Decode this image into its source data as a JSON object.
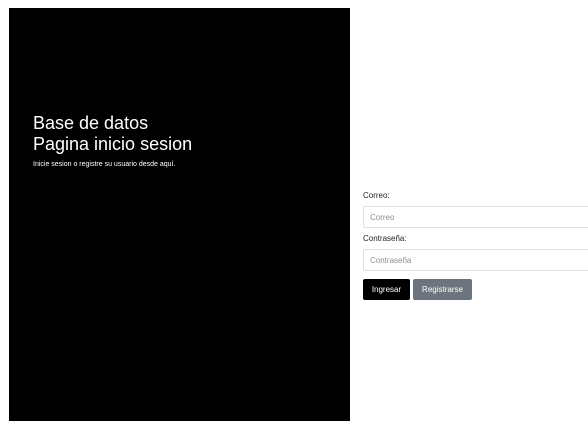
{
  "hero": {
    "title_line1": "Base de datos",
    "title_line2": "Pagina inicio sesion",
    "subtitle": "Inicie sesion o registre su usuario desde aquí."
  },
  "form": {
    "email_label": "Correo:",
    "email_placeholder": "Correo",
    "password_label": "Contraseña:",
    "password_placeholder": "Contraseña",
    "login_button": "Ingresar",
    "register_button": "Registrarse"
  },
  "colors": {
    "panel_background": "#000000",
    "primary_button": "#000000",
    "secondary_button": "#6c757d"
  }
}
